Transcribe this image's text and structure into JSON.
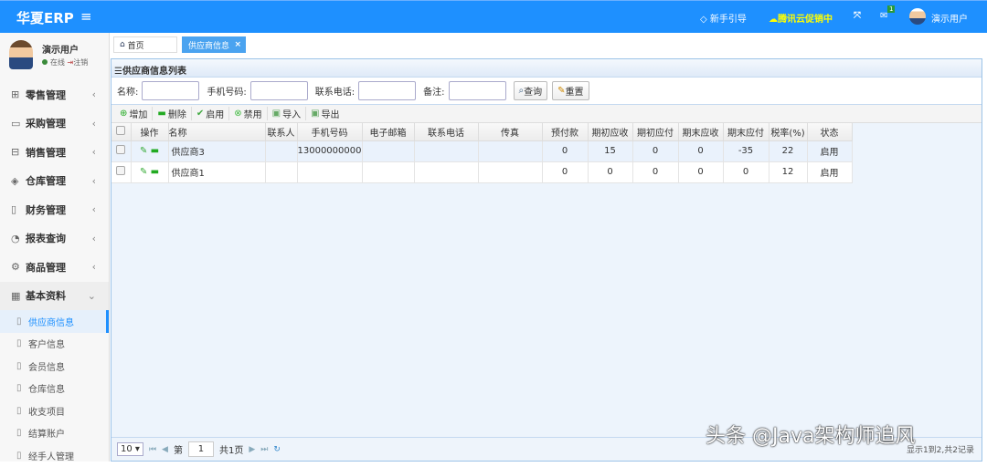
{
  "header": {
    "logo": "华夏ERP",
    "guide": "新手引导",
    "promo": "腾讯云促销中",
    "mail_badge": "1",
    "user": "演示用户",
    "promo_color": "#ffff00",
    "bar_color": "#1e90ff"
  },
  "sidebar": {
    "user": "演示用户",
    "online": "在线",
    "logout": "注销",
    "menus": [
      "零售管理",
      "采购管理",
      "销售管理",
      "仓库管理",
      "财务管理",
      "报表查询",
      "商品管理",
      "基本资料"
    ],
    "subs": [
      "供应商信息",
      "客户信息",
      "会员信息",
      "仓库信息",
      "收支项目",
      "结算账户",
      "经手人管理"
    ]
  },
  "tabs": {
    "home": "首页",
    "current": "供应商信息",
    "close": "×"
  },
  "panel": {
    "title": "供应商信息列表"
  },
  "search": {
    "name": "名称:",
    "mobile": "手机号码:",
    "phone": "联系电话:",
    "remark": "备注:",
    "query": "查询",
    "reset": "重置"
  },
  "toolbar": {
    "add": "增加",
    "delete": "删除",
    "enable": "启用",
    "disable": "禁用",
    "import": "导入",
    "export": "导出"
  },
  "table": {
    "headers": [
      "操作",
      "名称",
      "联系人",
      "手机号码",
      "电子邮箱",
      "联系电话",
      "传真",
      "预付款",
      "期初应收",
      "期初应付",
      "期末应收",
      "期末应付",
      "税率(%)",
      "状态"
    ],
    "rows": [
      [
        "供应商3",
        "",
        "13000000000",
        "",
        "",
        "",
        "0",
        "15",
        "0",
        "0",
        "-35",
        "22",
        "启用"
      ],
      [
        "供应商1",
        "",
        "",
        "",
        "",
        "",
        "0",
        "0",
        "0",
        "0",
        "0",
        "12",
        "启用"
      ]
    ]
  },
  "pager": {
    "size": "10",
    "page_prefix": "第",
    "page": "1",
    "page_suffix": "共1页",
    "info": "显示1到2,共2记录"
  },
  "watermark": "头条 @Java架构师追风"
}
